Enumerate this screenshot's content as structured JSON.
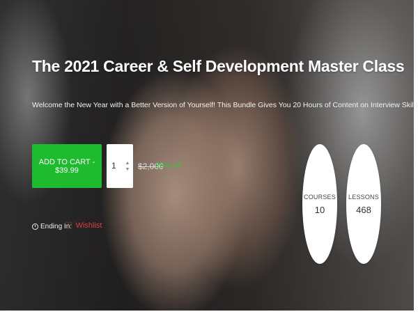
{
  "hero": {
    "title": "The 2021 Career & Self Development Master Class",
    "subtitle": "Welcome the New Year with a Better Version of Yourself! This Bundle Gives You 20 Hours of Content on Interview Skills, Speed Reading, Resume Building, & More"
  },
  "purchase": {
    "add_to_cart_label": "ADD TO CART - $39.99",
    "quantity": "1",
    "old_price": "$2,000",
    "discount": "98% off"
  },
  "meta": {
    "ending_label": "Ending In:",
    "wishlist_label": "Wishlist"
  },
  "stats": {
    "courses_label": "COURSES",
    "courses_value": "10",
    "lessons_label": "LESSONS",
    "lessons_value": "468"
  },
  "colors": {
    "accent_green": "#1fbb2f",
    "discount_green": "#36c23a",
    "wishlist_red": "#e03c3c"
  },
  "icons": [
    "up-arrow-icon",
    "down-arrow-icon",
    "clock-icon",
    "heart-icon"
  ]
}
